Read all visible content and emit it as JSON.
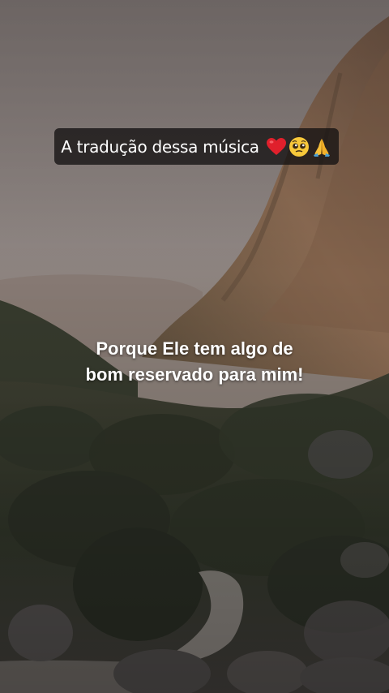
{
  "caption": {
    "text": "A tradução dessa música",
    "emojis": [
      "red-heart-emoji",
      "pleading-face-emoji",
      "folded-hands-emoji"
    ]
  },
  "lyric": {
    "line1": "Porque Ele tem algo de",
    "line2": "bom reservado para mim!"
  },
  "colors": {
    "caption_background": "#141212",
    "text": "#ffffff",
    "sky": "#8f8683",
    "mountain": "#7a5a45",
    "forest": "#2f3428"
  }
}
